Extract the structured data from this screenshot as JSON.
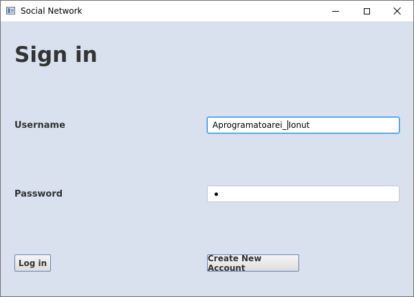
{
  "window": {
    "title": "Social Network",
    "icons": {
      "app": "window-app-icon",
      "minimize": "minimize-icon",
      "maximize": "maximize-icon",
      "close": "close-icon"
    }
  },
  "form": {
    "heading": "Sign in",
    "username_label": "Username",
    "username_value_before_caret": "Aprogramatoarei_",
    "username_value_after_caret": "Ionut",
    "password_label": "Password",
    "password_masked_length": 1
  },
  "buttons": {
    "login_label": "Log in",
    "create_account_label": "Create New Account"
  },
  "colors": {
    "background": "#d9e1ee",
    "text": "#333333",
    "focus_border": "#2a88d8",
    "button_border": "#5f84b8"
  }
}
